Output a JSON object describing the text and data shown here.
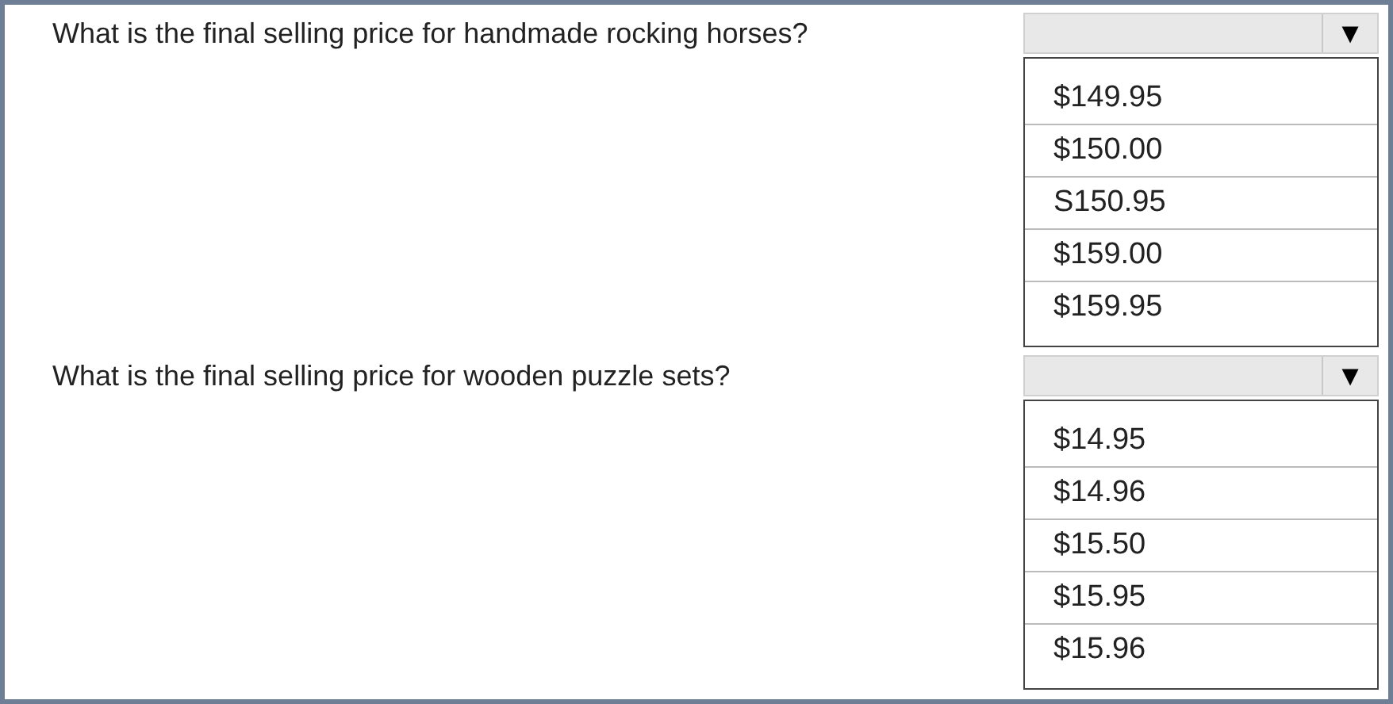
{
  "questions": [
    {
      "prompt": "What is the final selling price for handmade rocking horses?",
      "dropdown": {
        "expanded": true,
        "arrow": "▼",
        "options": [
          "$149.95",
          "$150.00",
          "S150.95",
          "$159.00",
          "$159.95"
        ]
      }
    },
    {
      "prompt": "What is the final selling price for wooden puzzle sets?",
      "dropdown": {
        "expanded": true,
        "arrow": "▼",
        "options": [
          "$14.95",
          "$14.96",
          "$15.50",
          "$15.95",
          "$15.96"
        ]
      }
    }
  ]
}
